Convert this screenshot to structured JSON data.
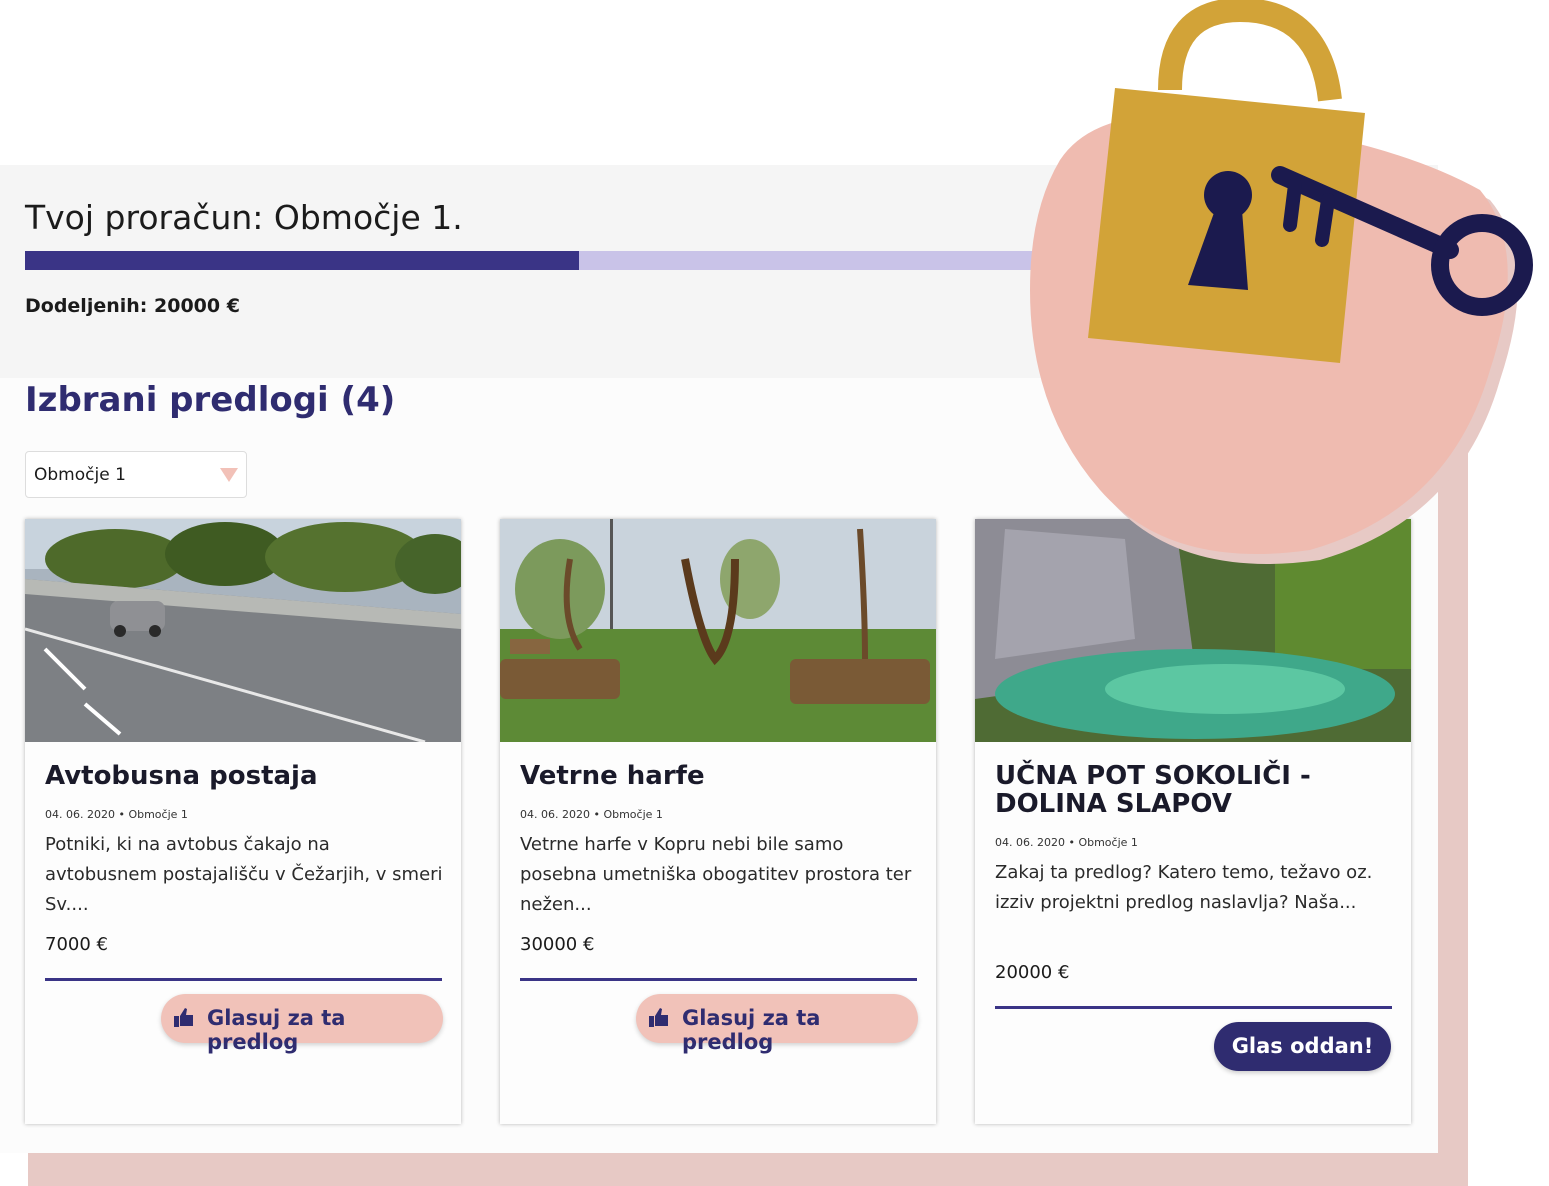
{
  "budget": {
    "title": "Tvoj proračun: Območje 1.",
    "allocated_label": "Dodeljenih: 20000 €",
    "progress_fraction": 0.495
  },
  "proposals": {
    "heading": "Izbrani predlogi (4)",
    "area_select": {
      "selected": "Območje 1"
    },
    "cards": [
      {
        "title": "Avtobusna postaja",
        "meta": "04. 06. 2020 • Območje 1",
        "description": "Potniki, ki na avtobus čakajo na avtobusnem postajališču v Čežarjih, v smeri Sv....",
        "price": "7000 €",
        "action": "Glasuj za ta predlog",
        "voted": false
      },
      {
        "title": "Vetrne harfe",
        "meta": "04. 06. 2020 • Območje 1",
        "description": "Vetrne harfe v Kopru nebi bile samo posebna umetniška obogatitev prostora ter nežen...",
        "price": "30000 €",
        "action": "Glasuj za ta predlog",
        "voted": false
      },
      {
        "title": "UČNA POT SOKOLIČI - DOLINA SLAPOV",
        "meta": "04. 06. 2020 • Območje 1",
        "description": "Zakaj ta predlog? Katero temo, težavo oz. izziv projektni predlog naslavlja? Naša...",
        "price": "20000 €",
        "action": "Glas oddan!",
        "voted": true
      }
    ]
  },
  "colors": {
    "accent": "#2f2c70",
    "progress_fill": "#3a3486",
    "progress_track": "#c9c3e8",
    "pink": "#f1c2b9",
    "lock_gold": "#d2a338"
  },
  "icons": [
    "chevron-down-icon",
    "thumbs-up-icon",
    "padlock-icon",
    "key-icon"
  ]
}
